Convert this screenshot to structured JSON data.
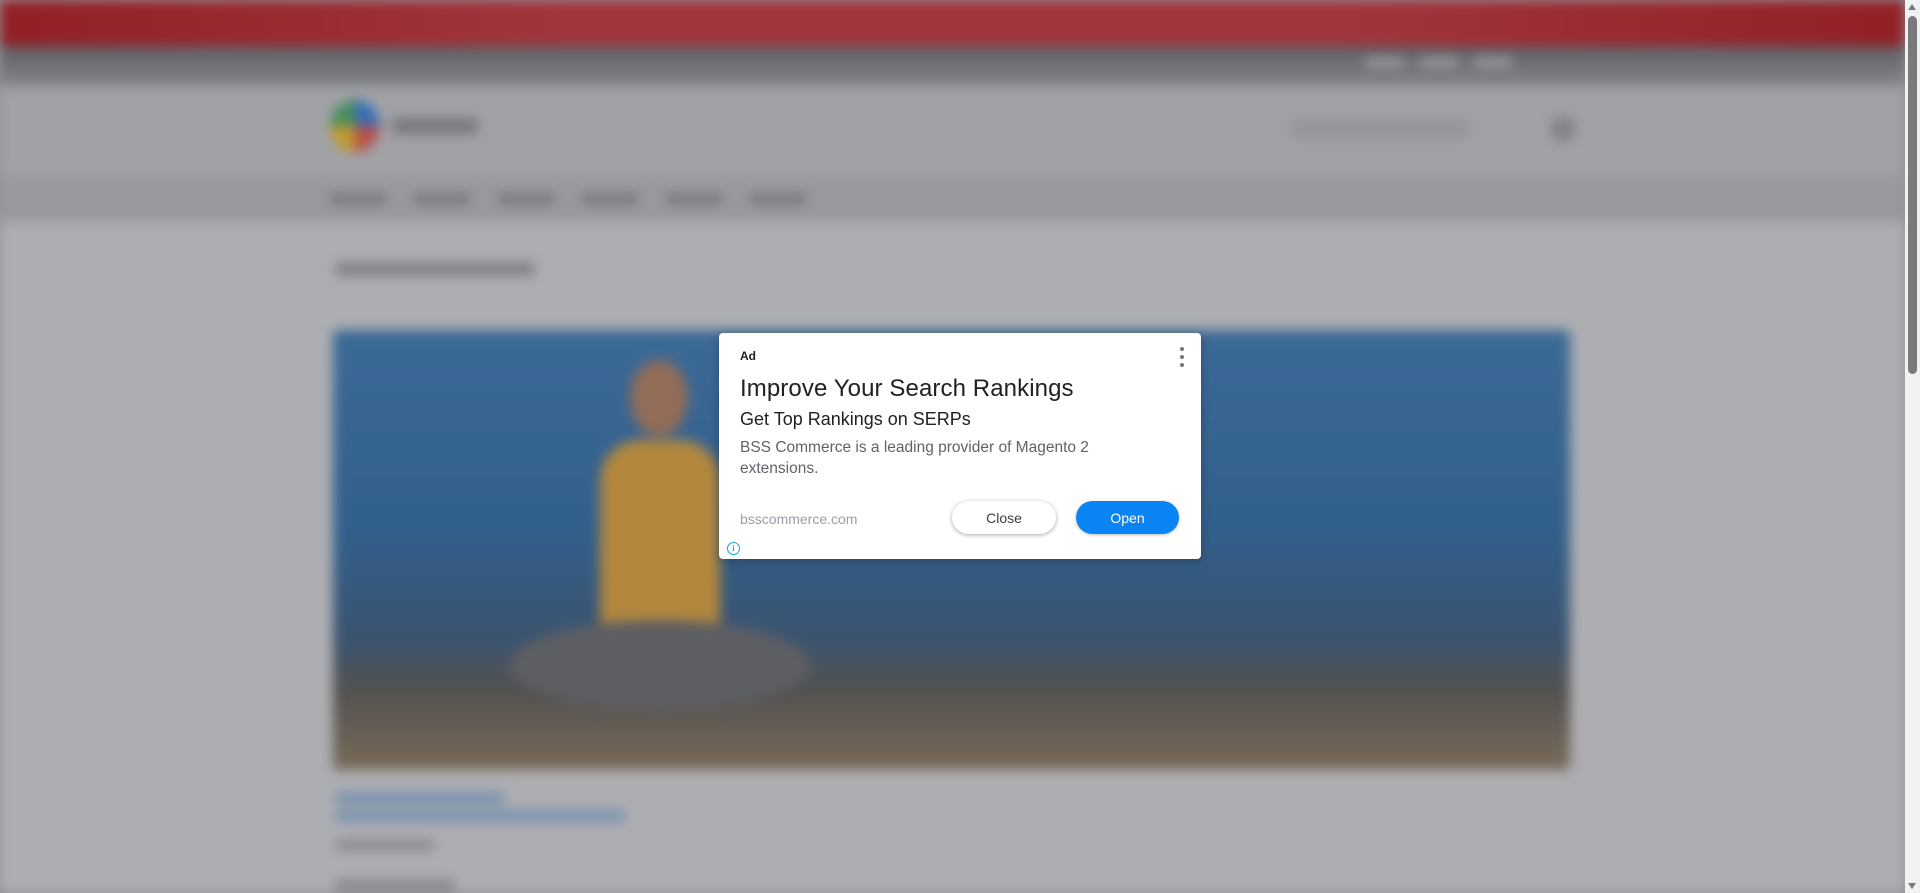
{
  "ad": {
    "label": "Ad",
    "headline": "Improve Your Search Rankings",
    "subheadline": "Get Top Rankings on SERPs",
    "body": "BSS Commerce is a leading provider of Magento 2 extensions.",
    "display_url": "bsscommerce.com",
    "close_label": "Close",
    "open_label": "Open",
    "info_glyph": "i",
    "menu_icon": "vertical-dots-icon"
  },
  "colors": {
    "open_button": "#0b84f3",
    "adchoices": "#00aecd",
    "top_bar": "#b3141a"
  }
}
